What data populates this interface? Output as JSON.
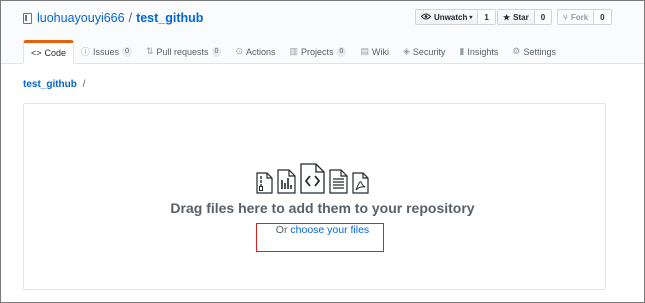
{
  "repo": {
    "owner": "luohuayouyi666",
    "separator": "/",
    "name": "test_github"
  },
  "actions": [
    {
      "label": "Unwatch",
      "suffix": "▾",
      "icon": "eye-icon",
      "count": "1"
    },
    {
      "label": "Star",
      "icon": "star-icon",
      "count": "0"
    },
    {
      "label": "Fork",
      "icon": "fork-icon",
      "count": "0",
      "disabled": true
    }
  ],
  "tabs": [
    {
      "label": "Code",
      "icon": "code-icon",
      "active": true
    },
    {
      "label": "Issues",
      "icon": "issue-icon",
      "badge": "0"
    },
    {
      "label": "Pull requests",
      "icon": "pull-request-icon",
      "badge": "0"
    },
    {
      "label": "Actions",
      "icon": "play-icon"
    },
    {
      "label": "Projects",
      "icon": "project-icon",
      "badge": "0"
    },
    {
      "label": "Wiki",
      "icon": "book-icon"
    },
    {
      "label": "Security",
      "icon": "shield-icon"
    },
    {
      "label": "Insights",
      "icon": "graph-icon"
    },
    {
      "label": "Settings",
      "icon": "gear-icon"
    }
  ],
  "breadcrumb": {
    "repo": "test_github",
    "slash": "/"
  },
  "upload": {
    "file_icons": [
      "file-zip-icon",
      "file-chart-icon",
      "file-code-icon",
      "file-text-icon",
      "file-pdf-icon"
    ],
    "heading": "Drag files here to add them to your repository",
    "choose_prefix": "Or",
    "choose_link": "choose your files"
  },
  "colors": {
    "link": "#0366d6",
    "active_tab_accent": "#e36209",
    "annotation_box": "#e0201c"
  }
}
